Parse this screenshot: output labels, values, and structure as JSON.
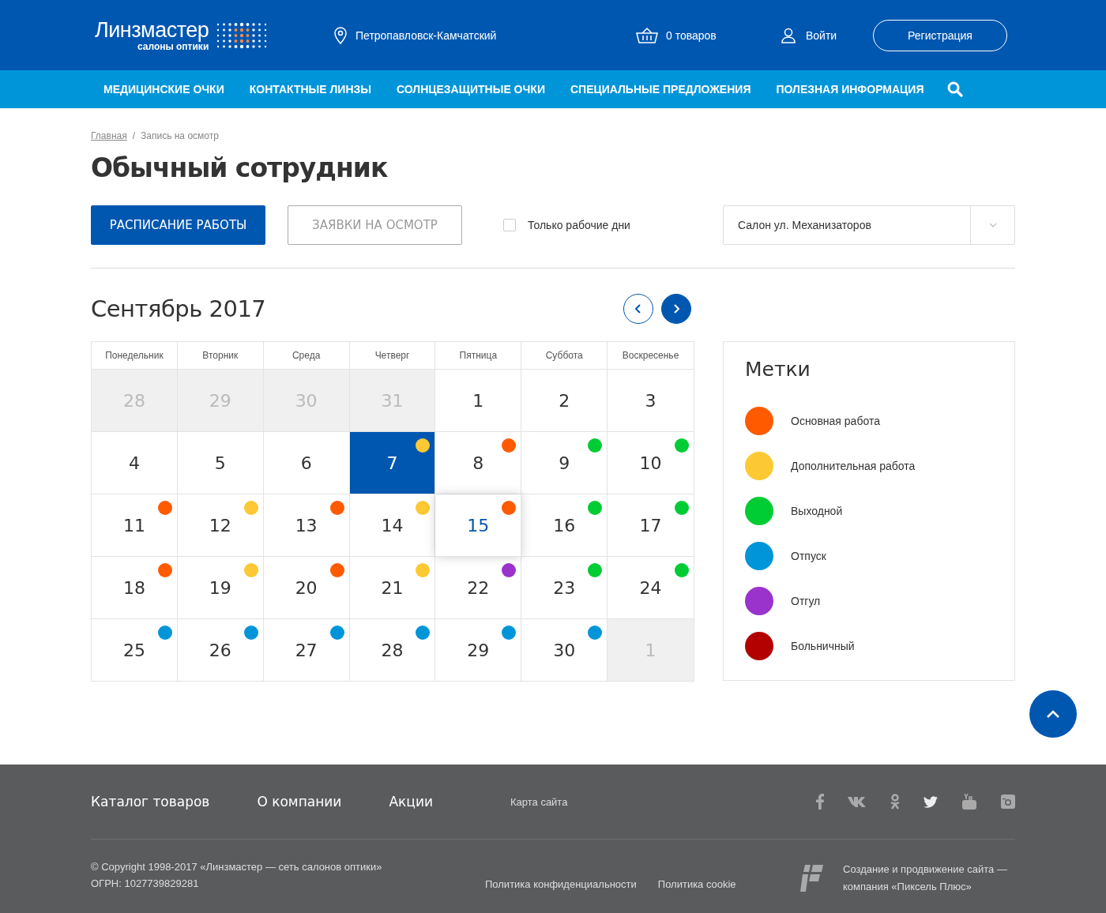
{
  "header": {
    "logo": {
      "name": "Линзмастер",
      "tagline": "салоны оптики"
    },
    "city": "Петропавловск-Камчатский",
    "cart": "0 товаров",
    "login": "Войти",
    "register": "Регистрация"
  },
  "nav": [
    "МЕДИЦИНСКИЕ ОЧКИ",
    "КОНТАКТНЫЕ ЛИНЗЫ",
    "СОЛНЦЕЗАЩИТНЫЕ ОЧКИ",
    "СПЕЦИАЛЬНЫЕ ПРЕДЛОЖЕНИЯ",
    "ПОЛЕЗНАЯ ИНФОРМАЦИЯ"
  ],
  "breadcrumb_separator": "/",
  "breadcrumbs": [
    {
      "label": "Главная",
      "link": true
    },
    {
      "label": "Запись на осмотр",
      "link": false
    }
  ],
  "title": "Обычный сотрудник",
  "tabs": [
    {
      "label": "РАСПИСАНИЕ РАБОТЫ",
      "selected": true
    },
    {
      "label": "ЗАЯВКИ НА ОСМОТР",
      "selected": false
    }
  ],
  "workdays_only": {
    "label": "Только рабочие дни",
    "checked": false
  },
  "salon_select": {
    "value": "Салон ул. Механизаторов"
  },
  "calendar": {
    "month": "Сентябрь 2017",
    "weekdays": [
      "Понедельник",
      "Вторник",
      "Среда",
      "Четверг",
      "Пятница",
      "Суббота",
      "Воскресенье"
    ],
    "days": [
      {
        "day": "28",
        "outside": true,
        "selected": false,
        "hovered": false
      },
      {
        "day": "29",
        "outside": true,
        "selected": false,
        "hovered": false
      },
      {
        "day": "30",
        "outside": true,
        "selected": false,
        "hovered": false
      },
      {
        "day": "31",
        "outside": true,
        "selected": false,
        "hovered": false
      },
      {
        "day": "1",
        "outside": false,
        "selected": false,
        "hovered": false
      },
      {
        "day": "2",
        "outside": false,
        "selected": false,
        "hovered": false
      },
      {
        "day": "3",
        "outside": false,
        "selected": false,
        "hovered": false
      },
      {
        "day": "4",
        "outside": false,
        "selected": false,
        "hovered": false
      },
      {
        "day": "5",
        "outside": false,
        "selected": false,
        "hovered": false
      },
      {
        "day": "6",
        "outside": false,
        "selected": false,
        "hovered": false
      },
      {
        "day": "7",
        "outside": false,
        "selected": true,
        "hovered": false,
        "color": "#fcc934"
      },
      {
        "day": "8",
        "outside": false,
        "selected": false,
        "hovered": false,
        "color": "#ff5a00"
      },
      {
        "day": "9",
        "outside": false,
        "selected": false,
        "hovered": false,
        "color": "#00cc33"
      },
      {
        "day": "10",
        "outside": false,
        "selected": false,
        "hovered": false,
        "color": "#00cc33"
      },
      {
        "day": "11",
        "outside": false,
        "selected": false,
        "hovered": false,
        "color": "#ff5a00"
      },
      {
        "day": "12",
        "outside": false,
        "selected": false,
        "hovered": false,
        "color": "#fcc934"
      },
      {
        "day": "13",
        "outside": false,
        "selected": false,
        "hovered": false,
        "color": "#ff5a00"
      },
      {
        "day": "14",
        "outside": false,
        "selected": false,
        "hovered": false,
        "color": "#fcc934"
      },
      {
        "day": "15",
        "outside": false,
        "selected": false,
        "hovered": true,
        "color": "#ff5a00"
      },
      {
        "day": "16",
        "outside": false,
        "selected": false,
        "hovered": false,
        "color": "#00cc33"
      },
      {
        "day": "17",
        "outside": false,
        "selected": false,
        "hovered": false,
        "color": "#00cc33"
      },
      {
        "day": "18",
        "outside": false,
        "selected": false,
        "hovered": false,
        "color": "#ff5a00"
      },
      {
        "day": "19",
        "outside": false,
        "selected": false,
        "hovered": false,
        "color": "#fcc934"
      },
      {
        "day": "20",
        "outside": false,
        "selected": false,
        "hovered": false,
        "color": "#ff5a00"
      },
      {
        "day": "21",
        "outside": false,
        "selected": false,
        "hovered": false,
        "color": "#fcc934"
      },
      {
        "day": "22",
        "outside": false,
        "selected": false,
        "hovered": false,
        "color": "#9933cc"
      },
      {
        "day": "23",
        "outside": false,
        "selected": false,
        "hovered": false,
        "color": "#00cc33"
      },
      {
        "day": "24",
        "outside": false,
        "selected": false,
        "hovered": false,
        "color": "#00cc33"
      },
      {
        "day": "25",
        "outside": false,
        "selected": false,
        "hovered": false,
        "color": "#0095d9"
      },
      {
        "day": "26",
        "outside": false,
        "selected": false,
        "hovered": false,
        "color": "#0095d9"
      },
      {
        "day": "27",
        "outside": false,
        "selected": false,
        "hovered": false,
        "color": "#0095d9"
      },
      {
        "day": "28",
        "outside": false,
        "selected": false,
        "hovered": false,
        "color": "#0095d9"
      },
      {
        "day": "29",
        "outside": false,
        "selected": false,
        "hovered": false,
        "color": "#0095d9"
      },
      {
        "day": "30",
        "outside": false,
        "selected": false,
        "hovered": false,
        "color": "#0095d9"
      },
      {
        "day": "1",
        "outside": true,
        "selected": false,
        "hovered": false
      }
    ]
  },
  "legend": {
    "title": "Метки",
    "items": [
      {
        "label": "Основная работа",
        "color": "#ff5a00"
      },
      {
        "label": "Дополнительная работа",
        "color": "#fcc934"
      },
      {
        "label": "Выходной",
        "color": "#00cc33"
      },
      {
        "label": "Отпуск",
        "color": "#0095d9"
      },
      {
        "label": "Отгул",
        "color": "#9933cc"
      },
      {
        "label": "Больничный",
        "color": "#b30000"
      }
    ]
  },
  "footer": {
    "menu": [
      "Каталог товаров",
      "О компании",
      "Акции"
    ],
    "sitemap": "Карта сайта",
    "copyright": "© Copyright 1998-2017 «Линзмастер — сеть салонов оптики»",
    "ogrn": "ОГРН: 1027739829281",
    "policies": [
      "Политика конфиденциальности",
      "Политика cookie"
    ],
    "developer": "Создание и продвижение сайта — компания «Пиксель Плюс»"
  }
}
